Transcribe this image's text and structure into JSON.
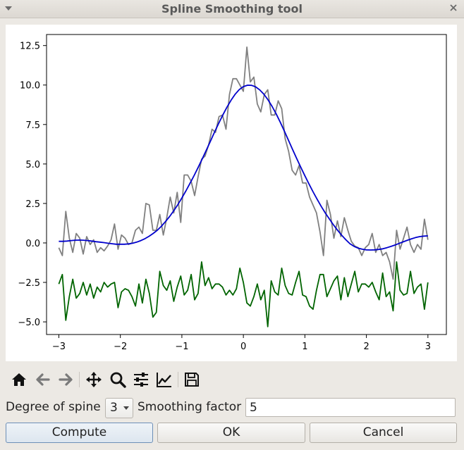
{
  "window": {
    "title": "Spline Smoothing tool",
    "menu_icon": "window-menu-icon",
    "close_icon": "close-icon"
  },
  "chart_data": {
    "type": "line",
    "title": "",
    "xlabel": "",
    "ylabel": "",
    "xlim": [
      -3.2,
      3.3
    ],
    "ylim": [
      -5.8,
      13.2
    ],
    "x_ticks": [
      -3,
      -2,
      -1,
      0,
      1,
      2,
      3
    ],
    "x_tick_labels": [
      "−3",
      "−2",
      "−1",
      "0",
      "1",
      "2",
      "3"
    ],
    "y_ticks": [
      -5,
      -2.5,
      0,
      2.5,
      5,
      7.5,
      10,
      12.5
    ],
    "y_tick_labels": [
      "−5.0",
      "−2.5",
      "0.0",
      "2.5",
      "5.0",
      "7.5",
      "10.0",
      "12.5"
    ],
    "grid": false,
    "x_range": [
      -3,
      3
    ],
    "series": [
      {
        "color": "#808080",
        "values": [
          -0.3,
          -0.8,
          2.0,
          0.3,
          -0.6,
          0.6,
          0.3,
          -0.7,
          0.4,
          -0.1,
          0.2,
          -0.6,
          -0.3,
          -0.5,
          -0.2,
          0.2,
          1.2,
          -0.4,
          0.5,
          0.3,
          -0.1,
          0.0,
          0.8,
          1.0,
          0.6,
          2.5,
          2.4,
          0.8,
          0.8,
          1.8,
          0.5,
          1.6,
          2.9,
          1.9,
          3.2,
          1.3,
          4.3,
          4.3,
          3.9,
          3.0,
          4.2,
          5.3,
          5.5,
          6.2,
          7.2,
          7.0,
          8.0,
          8.1,
          7.2,
          9.4,
          10.4,
          10.4,
          10.0,
          9.6,
          12.4,
          10.2,
          10.5,
          8.8,
          8.3,
          9.4,
          9.7,
          8.1,
          8.1,
          9.0,
          8.5,
          6.6,
          5.8,
          4.6,
          4.3,
          4.9,
          3.8,
          3.8,
          2.9,
          2.4,
          1.9,
          0.7,
          -0.8,
          2.7,
          1.8,
          0.3,
          1.4,
          0.4,
          1.6,
          0.8,
          0.1,
          -0.2,
          -0.3,
          -0.8,
          -0.3,
          -0.1,
          0.6,
          -0.6,
          -0.1,
          -0.8,
          -0.6,
          -1.2,
          -2.3,
          0.8,
          -0.4,
          0.3,
          1.0,
          -0.1,
          -0.6,
          -0.1,
          -0.4,
          1.5,
          0.2
        ]
      },
      {
        "color": "#0000cc",
        "values": [
          0.1,
          0.1,
          0.12,
          0.15,
          0.17,
          0.18,
          0.17,
          0.15,
          0.12,
          0.08,
          0.05,
          0.02,
          -0.02,
          -0.05,
          -0.08,
          -0.08,
          -0.08,
          -0.06,
          -0.02,
          0.05,
          0.15,
          0.27,
          0.42,
          0.6,
          0.8,
          1.05,
          1.35,
          1.67,
          2.03,
          2.42,
          2.85,
          3.3,
          3.78,
          4.28,
          4.8,
          5.34,
          5.9,
          6.46,
          7.03,
          7.58,
          8.11,
          8.6,
          9.04,
          9.42,
          9.71,
          9.9,
          9.99,
          9.98,
          9.88,
          9.69,
          9.42,
          9.07,
          8.65,
          8.17,
          7.64,
          7.08,
          6.5,
          5.92,
          5.35,
          4.79,
          4.25,
          3.73,
          3.23,
          2.76,
          2.31,
          1.89,
          1.5,
          1.13,
          0.79,
          0.48,
          0.2,
          -0.05,
          -0.22,
          -0.33,
          -0.4,
          -0.44,
          -0.45,
          -0.44,
          -0.41,
          -0.37,
          -0.3,
          -0.22,
          -0.13,
          -0.03,
          0.07,
          0.17,
          0.26,
          0.34,
          0.4,
          0.43,
          0.45
        ]
      },
      {
        "color": "#006400",
        "values": [
          -2.6,
          -2.0,
          -4.9,
          -3.4,
          -2.3,
          -3.5,
          -3.2,
          -2.5,
          -3.3,
          -2.6,
          -3.5,
          -2.8,
          -3.1,
          -2.5,
          -2.8,
          -2.6,
          -2.5,
          -4.1,
          -3.1,
          -2.9,
          -3.0,
          -3.4,
          -4.0,
          -2.6,
          -3.8,
          -2.3,
          -3.2,
          -4.7,
          -4.4,
          -1.8,
          -2.7,
          -3.0,
          -2.4,
          -3.7,
          -2.8,
          -2.1,
          -3.3,
          -3.0,
          -2.0,
          -3.6,
          -3.2,
          -1.2,
          -2.7,
          -2.2,
          -2.9,
          -2.6,
          -2.6,
          -2.8,
          -3.3,
          -3.0,
          -3.3,
          -2.9,
          -1.6,
          -2.5,
          -3.8,
          -4.0,
          -3.4,
          -2.6,
          -3.6,
          -3.0,
          -5.3,
          -2.4,
          -3.1,
          -3.3,
          -1.6,
          -2.7,
          -3.2,
          -3.3,
          -2.5,
          -1.8,
          -3.3,
          -3.4,
          -4.0,
          -4.2,
          -3.0,
          -2.0,
          -2.0,
          -3.4,
          -2.9,
          -2.4,
          -2.1,
          -3.6,
          -2.2,
          -3.4,
          -2.6,
          -1.8,
          -3.1,
          -2.6,
          -2.6,
          -2.8,
          -2.5,
          -3.1,
          -3.6,
          -1.9,
          -3.4,
          -3.1,
          -4.3,
          -1.2,
          -3.0,
          -3.3,
          -3.2,
          -1.8,
          -3.2,
          -2.8,
          -2.6,
          -4.2,
          -2.5
        ]
      }
    ]
  },
  "toolbar": {
    "items": [
      {
        "name": "home-icon"
      },
      {
        "name": "back-arrow-icon"
      },
      {
        "name": "forward-arrow-icon"
      },
      {
        "name": "pan-icon"
      },
      {
        "name": "zoom-icon"
      },
      {
        "name": "subplots-config-icon"
      },
      {
        "name": "edit-curves-icon"
      },
      {
        "name": "save-icon"
      }
    ]
  },
  "controls": {
    "degree_label": "Degree of spine",
    "degree_value": "3",
    "smoothing_label": "Smoothing factor",
    "smoothing_value": "5"
  },
  "buttons": {
    "compute": "Compute",
    "ok": "OK",
    "cancel": "Cancel"
  }
}
